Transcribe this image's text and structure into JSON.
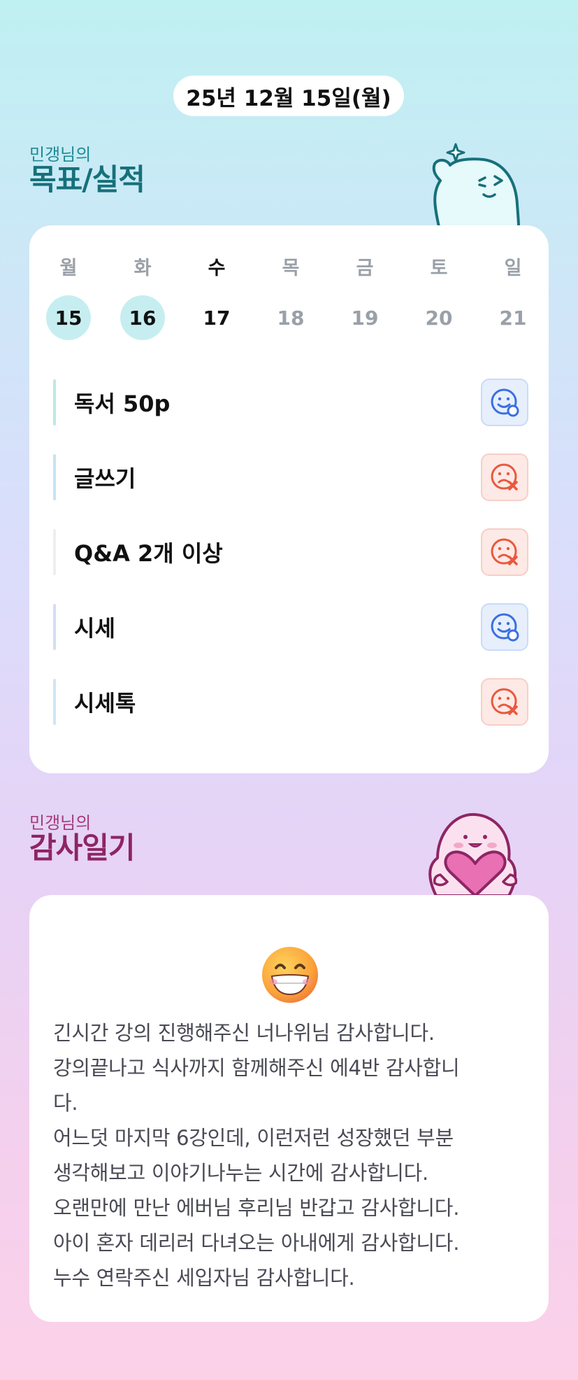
{
  "header": {
    "date": "25년 12월 15일(월)"
  },
  "goals_section": {
    "subtitle": "민갱님의",
    "title": "목표/실적"
  },
  "week": {
    "days": [
      {
        "name": "월",
        "num": "15",
        "state": "done"
      },
      {
        "name": "화",
        "num": "16",
        "state": "done"
      },
      {
        "name": "수",
        "num": "17",
        "state": "today"
      },
      {
        "name": "목",
        "num": "18",
        "state": "future"
      },
      {
        "name": "금",
        "num": "19",
        "state": "future"
      },
      {
        "name": "토",
        "num": "20",
        "state": "future"
      },
      {
        "name": "일",
        "num": "21",
        "state": "future"
      }
    ]
  },
  "goals": [
    {
      "label": "독서 50p",
      "status": "achieved",
      "bar_color": "#bde8e6"
    },
    {
      "label": "글쓰기",
      "status": "failed",
      "bar_color": "#c5e4f4"
    },
    {
      "label": "Q&A 2개 이상",
      "status": "failed",
      "bar_color": "#eeeeee"
    },
    {
      "label": "시세",
      "status": "achieved",
      "bar_color": "#d1dff5"
    },
    {
      "label": "시세톡",
      "status": "failed",
      "bar_color": "#cfe6f5"
    }
  ],
  "diary_section": {
    "subtitle": "민갱님의",
    "title": "감사일기"
  },
  "diary": {
    "emoji": "grinning-face",
    "text": "긴시간 강의 진행해주신 너나위님 감사합니다.\n강의끝나고 식사까지 함께해주신 에4반 감사합니\n다.\n어느덧 마지막 6강인데, 이런저런 성장했던 부분\n생각해보고 이야기나누는 시간에 감사합니다.\n오랜만에 만난 에버님 후리님 반갑고 감사합니다.\n아이 혼자 데리러 다녀오는 아내에게 감사합니다.\n누수 연락주신 세입자님 감사합니다."
  },
  "colors": {
    "achieved": "#3b6fe0",
    "failed": "#e8593f",
    "done_day": "#c6eef1"
  }
}
